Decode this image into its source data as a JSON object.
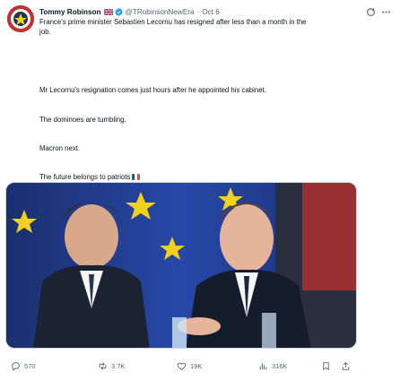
{
  "tweet": {
    "author_name": "Tommy Robinson",
    "author_handle": "@TRobinsonNewEra",
    "separator": "·",
    "date": "Oct 6",
    "text_line_1": "France's prime minister Sebastien Lecornu has resigned after less than a month in the job.",
    "paragraph_2": "Mr Lecornu's resignation comes just hours after he appointed his cabinet.",
    "paragraph_3": "The dominoes are tumbling.",
    "paragraph_4": "Macron next.",
    "paragraph_5": "The future belongs to patriots",
    "icons": {
      "avatar": "avatar",
      "flag": "union-jack-flag-icon",
      "verified": "verified-badge-icon",
      "grok": "grok-icon",
      "more": "more-icon",
      "french_flag": "french-flag-icon"
    }
  },
  "actions": {
    "replies": "570",
    "reposts": "3.7K",
    "likes": "19K",
    "views": "316K"
  },
  "colors": {
    "secondary_text": "#536471",
    "verified_blue": "#1d9bf0",
    "eu_blue": "#1f3d99",
    "eu_star": "#f2d11a"
  }
}
